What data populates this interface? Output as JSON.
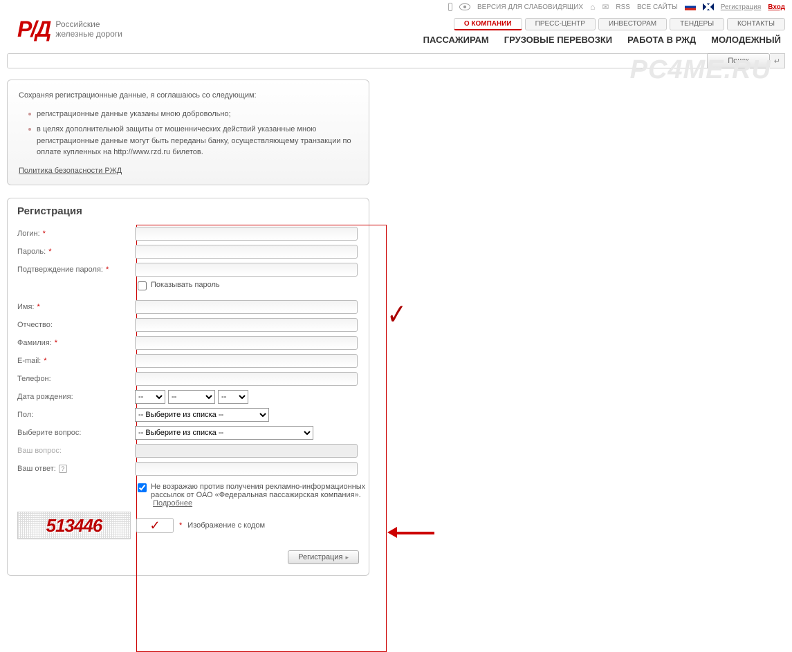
{
  "topbar": {
    "accessibility": "ВЕРСИЯ ДЛЯ СЛАБОВИДЯЩИХ",
    "rss": "RSS",
    "all_sites": "ВСЕ САЙТЫ",
    "register": "Регистрация",
    "login": "Вход"
  },
  "logo": {
    "sub1": "Российские",
    "sub2": "железные дороги"
  },
  "minitabs": {
    "about": "О КОМПАНИИ",
    "press": "ПРЕСС-ЦЕНТР",
    "investors": "ИНВЕСТОРАМ",
    "tenders": "ТЕНДЕРЫ",
    "contacts": "КОНТАКТЫ"
  },
  "maintabs": {
    "passengers": "ПАССАЖИРАМ",
    "cargo": "ГРУЗОВЫЕ ПЕРЕВОЗКИ",
    "jobs": "РАБОТА В РЖД",
    "youth": "МОЛОДЕЖНЫЙ"
  },
  "search": {
    "button": "Поиск"
  },
  "consent": {
    "intro": "Сохраняя регистрационные данные, я соглашаюсь со следующим:",
    "item1": "регистрационные данные указаны мною добровольно;",
    "item2": "в целях дополнительной защиты от мошеннических действий указанные мною регистрационные данные могут быть переданы банку, осуществляющему транзакции по оплате купленных на http://www.rzd.ru билетов.",
    "policy": "Политика безопасности РЖД"
  },
  "form": {
    "title": "Регистрация",
    "labels": {
      "login": "Логин:",
      "password": "Пароль:",
      "password_confirm": "Подтверждение пароля:",
      "show_password": "Показывать пароль",
      "firstname": "Имя:",
      "patronymic": "Отчество:",
      "lastname": "Фамилия:",
      "email": "E-mail:",
      "phone": "Телефон:",
      "dob": "Дата рождения:",
      "gender": "Пол:",
      "select_question": "Выберите вопрос:",
      "your_question": "Ваш вопрос:",
      "your_answer": "Ваш ответ:",
      "consent_mailing": "Не возражаю против получения рекламно-информационных рассылок от ОАО «Федеральная пассажирская компания».",
      "more": "Подробнее",
      "captcha_label": "Изображение с кодом"
    },
    "select_placeholder_short": "--",
    "select_from_list": "-- Выберите из списка --",
    "captcha_code": "513446",
    "submit": "Регистрация"
  },
  "watermark": "PC4ME.RU"
}
